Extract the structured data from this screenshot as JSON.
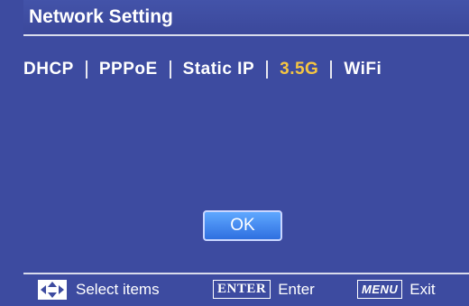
{
  "title": "Network Setting",
  "tabs": [
    {
      "label": "DHCP",
      "active": false
    },
    {
      "label": "PPPoE",
      "active": false
    },
    {
      "label": "Static IP",
      "active": false
    },
    {
      "label": "3.5G",
      "active": true
    },
    {
      "label": "WiFi",
      "active": false
    }
  ],
  "ok_button": "OK",
  "footer": {
    "select": {
      "icon": "directional-arrows-icon",
      "label": "Select items"
    },
    "enter": {
      "key": "ENTER",
      "label": "Enter"
    },
    "exit": {
      "key": "MENU",
      "label": "Exit"
    }
  },
  "colors": {
    "background": "#3d4ba0",
    "active_tab": "#f5c542",
    "ok_button": "#3f86f0"
  }
}
